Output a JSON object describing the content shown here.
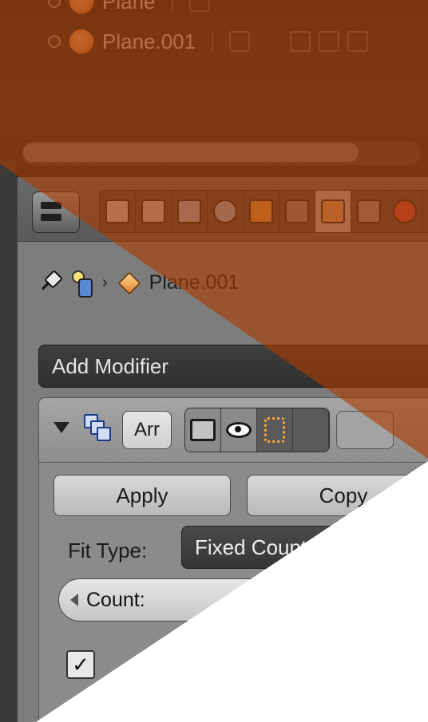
{
  "outliner": {
    "rows": [
      {
        "label": "Plane"
      },
      {
        "label": "Plane.001"
      }
    ]
  },
  "properties": {
    "breadcrumb": {
      "object_name": "Plane.001"
    },
    "add_modifier_label": "Add Modifier",
    "modifier": {
      "name": "Arr",
      "apply_label": "Apply",
      "copy_label": "Copy",
      "fit_type_label": "Fit Type:",
      "fit_type_value": "Fixed Count",
      "count_label": "Count:"
    },
    "checkbox_mark": "✓"
  },
  "icons": [
    "pin-icon",
    "scene-icon",
    "cube-icon",
    "array-modifier-icon",
    "camera-icon",
    "eye-icon",
    "editmode-icon",
    "cage-icon"
  ],
  "colors": {
    "overlay": "#aa3c00",
    "panel": "#7d7d7d",
    "button": "#d0d0d0"
  }
}
